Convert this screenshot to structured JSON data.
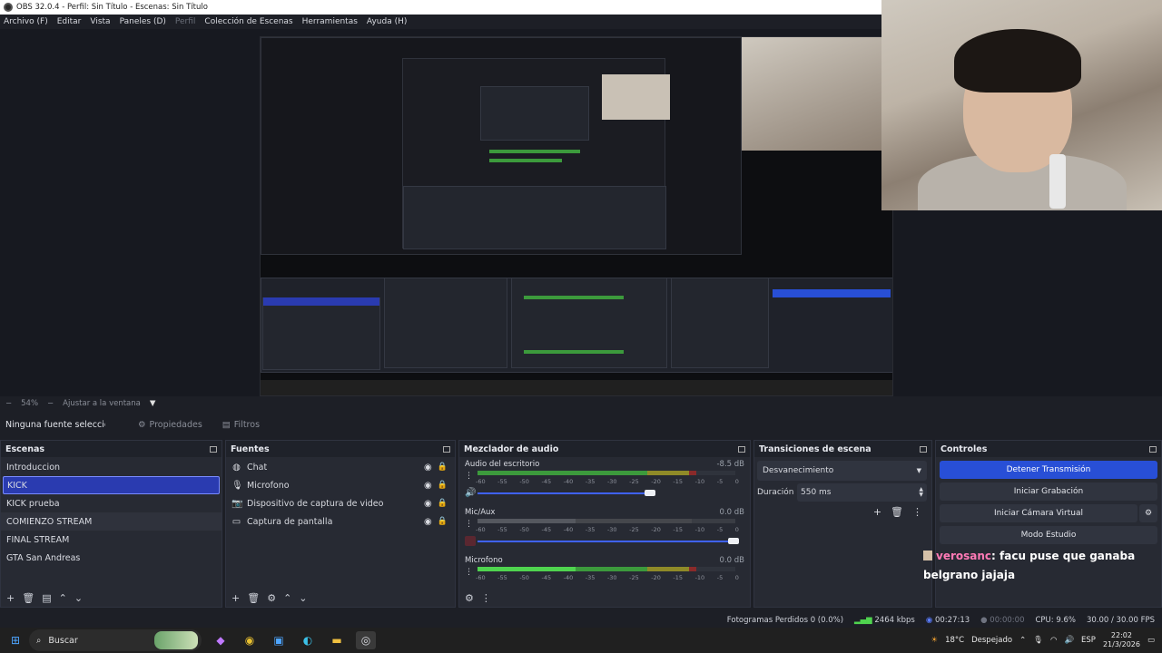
{
  "window": {
    "title": "OBS 32.0.4 - Perfil: Sin Título - Escenas: Sin Título"
  },
  "menu": [
    {
      "label": "Archivo (F)",
      "dim": false
    },
    {
      "label": "Editar",
      "dim": false
    },
    {
      "label": "Vista",
      "dim": false
    },
    {
      "label": "Paneles (D)",
      "dim": false
    },
    {
      "label": "Perfil",
      "dim": true
    },
    {
      "label": "Colección de Escenas",
      "dim": false
    },
    {
      "label": "Herramientas",
      "dim": false
    },
    {
      "label": "Ayuda (H)",
      "dim": false
    }
  ],
  "zoom": {
    "value": "54%",
    "fit_label": "Ajustar a la ventana"
  },
  "source_toolbar": {
    "none_selected": "Ninguna fuente seleccionada",
    "properties": "Propiedades",
    "filters": "Filtros"
  },
  "scenes": {
    "title": "Escenas",
    "items": [
      "Introduccion",
      "KICK",
      "KICK prueba",
      "COMIENZO STREAM",
      "FINAL STREAM",
      "GTA San Andreas"
    ],
    "selected_index": 1
  },
  "sources": {
    "title": "Fuentes",
    "items": [
      {
        "label": "Chat",
        "icon": "globe-icon"
      },
      {
        "label": "Microfono",
        "icon": "microphone-icon"
      },
      {
        "label": "Dispositivo de captura de video",
        "icon": "camera-icon"
      },
      {
        "label": "Captura de pantalla",
        "icon": "monitor-icon"
      }
    ]
  },
  "mixer": {
    "title": "Mezclador de audio",
    "ticks": [
      "-60",
      "-55",
      "-50",
      "-45",
      "-40",
      "-35",
      "-30",
      "-25",
      "-20",
      "-15",
      "-10",
      "-5",
      "0"
    ],
    "channels": [
      {
        "name": "Audio del escritorio",
        "db": "-8.5 dB",
        "level": 0.85,
        "volume": 0.67
      },
      {
        "name": "Mic/Aux",
        "db": "0.0 dB",
        "level": 0.0,
        "volume": 1.0
      },
      {
        "name": "Microfono",
        "db": "0.0 dB",
        "level": 0.55,
        "volume": 1.0
      }
    ]
  },
  "transitions": {
    "title": "Transiciones de escena",
    "current": "Desvanecimiento",
    "duration_label": "Duración",
    "duration_value": "550 ms"
  },
  "controls": {
    "title": "Controles",
    "buttons": [
      "Detener Transmisión",
      "Iniciar Grabación",
      "Iniciar Cámara Virtual",
      "Modo Estudio"
    ]
  },
  "chat": {
    "user": "verosanc",
    "message": ": facu puse que ganaba belgrano jajaja"
  },
  "status": {
    "dropped": "Fotogramas Perdidos 0 (0.0%)",
    "bitrate": "2464 kbps",
    "stream_time": "00:27:13",
    "rec_time": "00:00:00",
    "cpu": "CPU: 9.6%",
    "fps": "30.00 / 30.00 FPS"
  },
  "taskbar": {
    "search": "Buscar",
    "weather": "18°C",
    "weather_desc": "Despejado",
    "lang": "ESP",
    "time": "22:02",
    "date": "21/3/2026"
  }
}
